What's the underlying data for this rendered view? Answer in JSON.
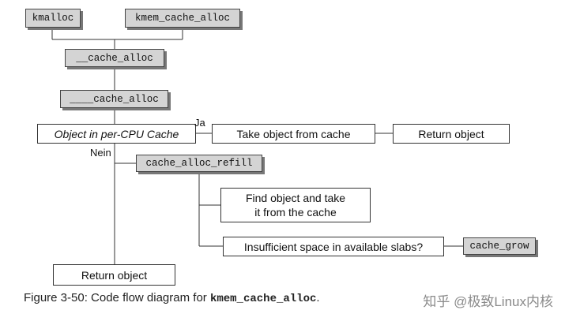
{
  "nodes": {
    "kmalloc": "kmalloc",
    "kmem_cache_alloc": "kmem_cache_alloc",
    "__cache_alloc": "__cache_alloc",
    "____cache_alloc": "____cache_alloc",
    "object_in_percpu": "Object in per-CPU Cache",
    "take_object": "Take object from cache",
    "return_object_top": "Return object",
    "cache_alloc_refill": "cache_alloc_refill",
    "find_object_line1": "Find object and take",
    "find_object_line2": "it from the cache",
    "insufficient_space": "Insufficient space in available slabs?",
    "cache_grow": "cache_grow",
    "return_object_bottom": "Return object"
  },
  "labels": {
    "yes": "Ja",
    "no": "Nein"
  },
  "caption": {
    "prefix": "Figure 3-50: Code flow diagram for ",
    "code": "kmem_cache_alloc",
    "suffix": "."
  },
  "watermark": "知乎 @极致Linux内核",
  "colors": {
    "function_box_fill": "#d4d4d4",
    "function_box_shadow": "#777777",
    "line": "#333333"
  }
}
